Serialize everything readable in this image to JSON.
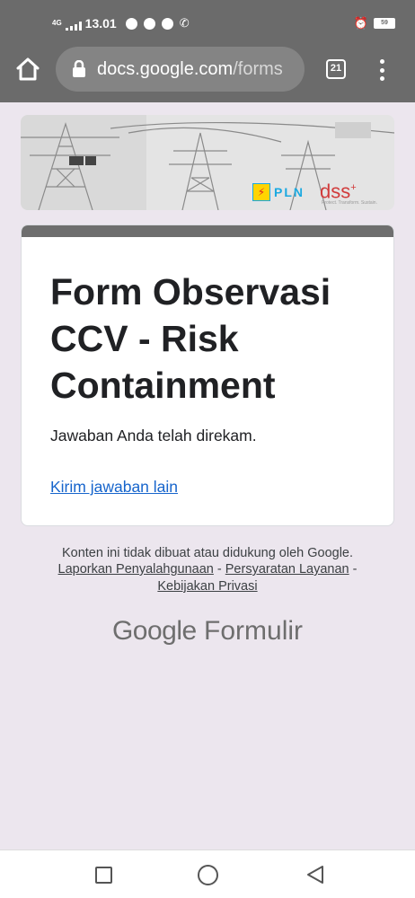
{
  "status_bar": {
    "network": "4G",
    "time": "13.01",
    "battery": "59"
  },
  "browser": {
    "url_domain": "docs.google.com",
    "url_path": "/forms",
    "tab_count": "21"
  },
  "banner": {
    "pln_label": "PLN",
    "dss_label": "dss",
    "dss_plus": "+",
    "dss_tagline": "Protect. Transform. Sustain."
  },
  "form": {
    "title": "Form Observasi CCV - Risk Containment",
    "confirmation": "Jawaban Anda telah direkam.",
    "submit_another": "Kirim jawaban lain"
  },
  "footer": {
    "disclaimer": "Konten ini tidak dibuat atau didukung oleh Google.",
    "report_abuse": "Laporkan Penyalahgunaan",
    "terms": "Persyaratan Layanan",
    "privacy": "Kebijakan Privasi",
    "separator": " - ",
    "brand_google": "Google",
    "brand_forms": "Formulir"
  },
  "colors": {
    "chrome": "#6b6b6b",
    "page_bg": "#ece6ee",
    "link": "#1765cc",
    "card_band": "#6e6e6e"
  }
}
